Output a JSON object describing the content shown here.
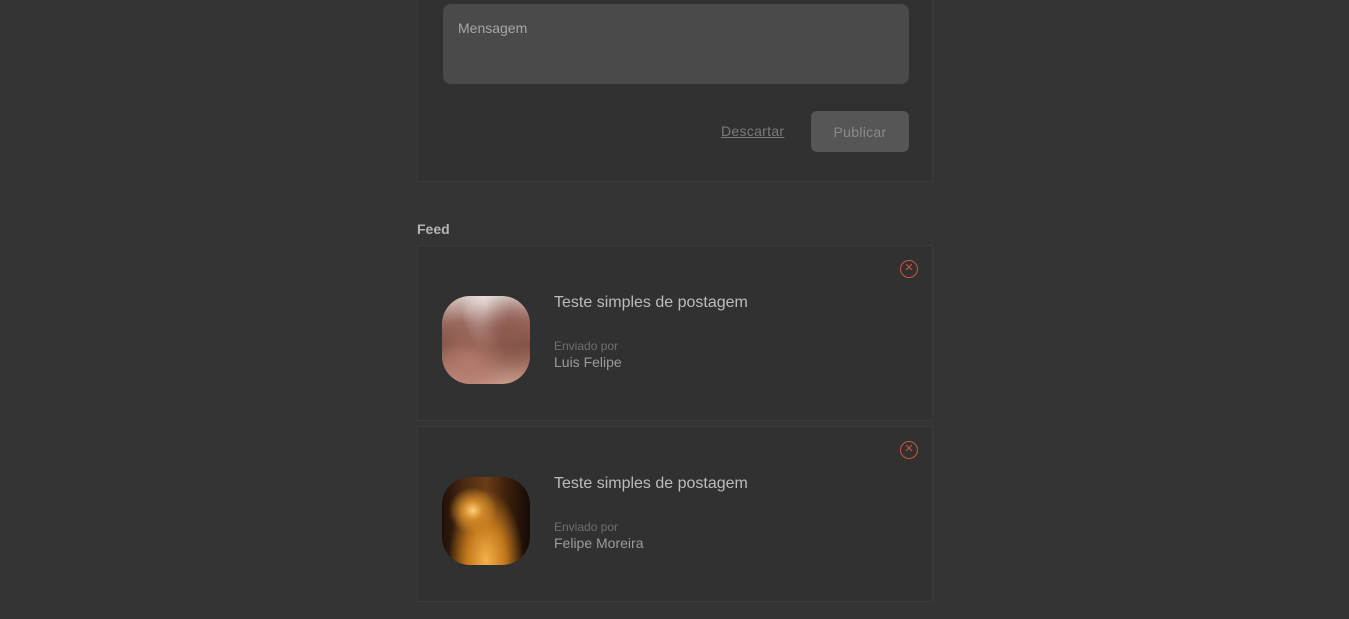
{
  "composer": {
    "message_placeholder": "Mensagem",
    "message_value": "",
    "discard_label": "Descartar",
    "publish_label": "Publicar"
  },
  "feed": {
    "heading": "Feed",
    "posts": [
      {
        "title": "Teste simples de postagem",
        "sent_by_label": "Enviado por",
        "author": "Luis Felipe",
        "image": "rock-landscape-photo",
        "delete_icon": "close-circle-icon"
      },
      {
        "title": "Teste simples de postagem",
        "sent_by_label": "Enviado por",
        "author": "Felipe Moreira",
        "image": "autumn-forest-path-photo",
        "delete_icon": "close-circle-icon"
      }
    ]
  },
  "colors": {
    "background": "#343434",
    "card": "#313131",
    "accent_delete": "#c9573a"
  }
}
